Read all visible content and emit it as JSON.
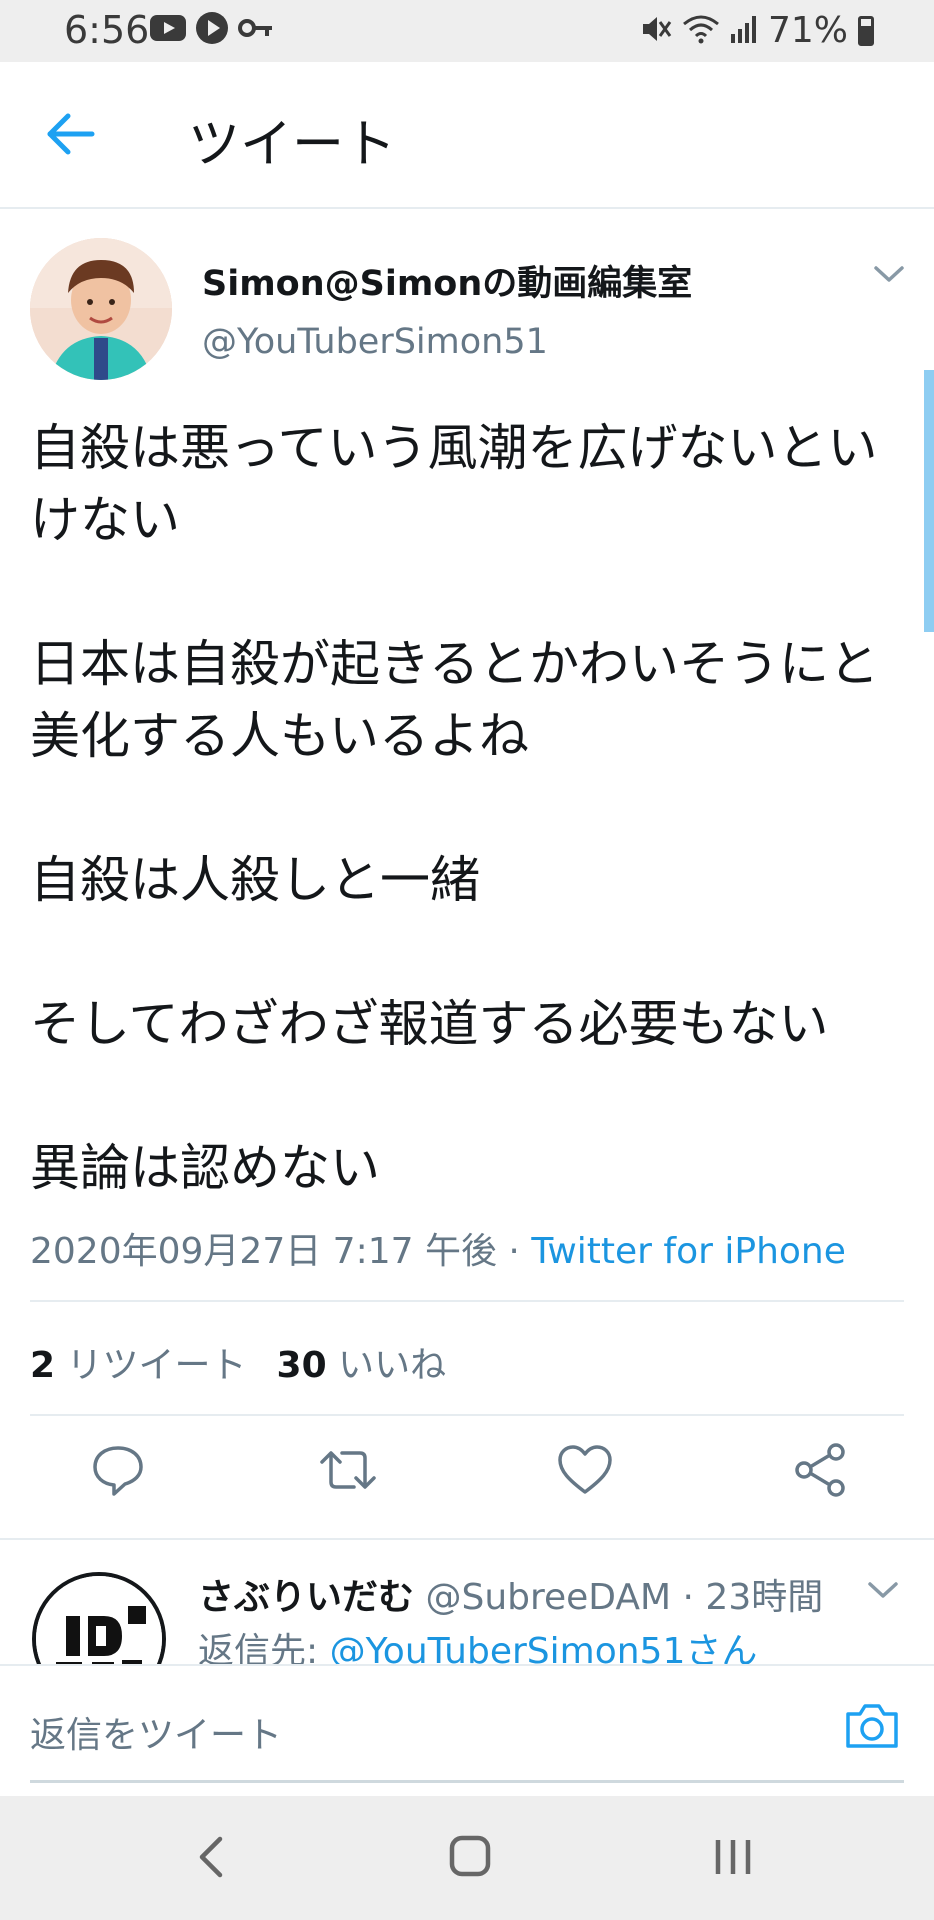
{
  "status_bar": {
    "time": "6:56",
    "battery": "71%",
    "icons": [
      "youtube-icon",
      "play-icon",
      "key-icon",
      "mute-icon",
      "wifi-icon",
      "signal-icon",
      "battery-icon"
    ]
  },
  "header": {
    "title": "ツイート"
  },
  "tweet": {
    "author_name": "Simon@Simonの動画編集室",
    "author_handle": "@YouTuberSimon51",
    "paragraphs": [
      "自殺は悪っていう風潮を広げないといけない",
      "日本は自殺が起きるとかわいそうにと美化する人もいるよね",
      "自殺は人殺しと一緒",
      "そしてわざわざ報道する必要もない",
      "異論は認めない"
    ],
    "timestamp": "2020年09月27日 7:17 午後",
    "separator": " · ",
    "source": "Twitter for iPhone",
    "retweets_count": "2",
    "retweets_label": "リツイート",
    "likes_count": "30",
    "likes_label": "いいね"
  },
  "reply": {
    "name": "さぶりいだむ",
    "handle": "@SubreeDAM",
    "separator": " · ",
    "time": "23時間",
    "reply_to_label": "返信先: ",
    "reply_to_mention": "@YouTuberSimon51さん"
  },
  "compose": {
    "placeholder": "返信をツイート"
  },
  "colors": {
    "accent": "#1b95e0",
    "secondary_text": "#657786",
    "primary_text": "#14171a"
  }
}
